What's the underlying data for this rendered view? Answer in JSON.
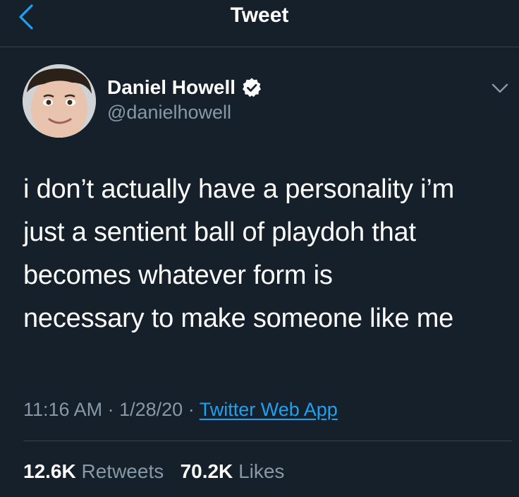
{
  "header": {
    "title": "Tweet"
  },
  "author": {
    "display_name": "Daniel Howell",
    "handle": "@danielhowell",
    "verified": true
  },
  "tweet": {
    "text": "i don’t actually have a personality i’m\njust a sentient ball of playdoh that\nbecomes whatever form is\nnecessary to make someone like me",
    "time": "11:16 AM",
    "date": "1/28/20",
    "separator": "·",
    "source": "Twitter Web App"
  },
  "stats": {
    "retweets_count": "12.6K",
    "retweets_label": "Retweets",
    "likes_count": "70.2K",
    "likes_label": "Likes"
  },
  "colors": {
    "background": "#15202b",
    "accent": "#1da1f2",
    "secondary_text": "#8899a6",
    "divider": "#38444d"
  },
  "icons": {
    "back": "chevron-left-icon",
    "verified": "verified-badge-icon",
    "more": "chevron-down-icon"
  }
}
